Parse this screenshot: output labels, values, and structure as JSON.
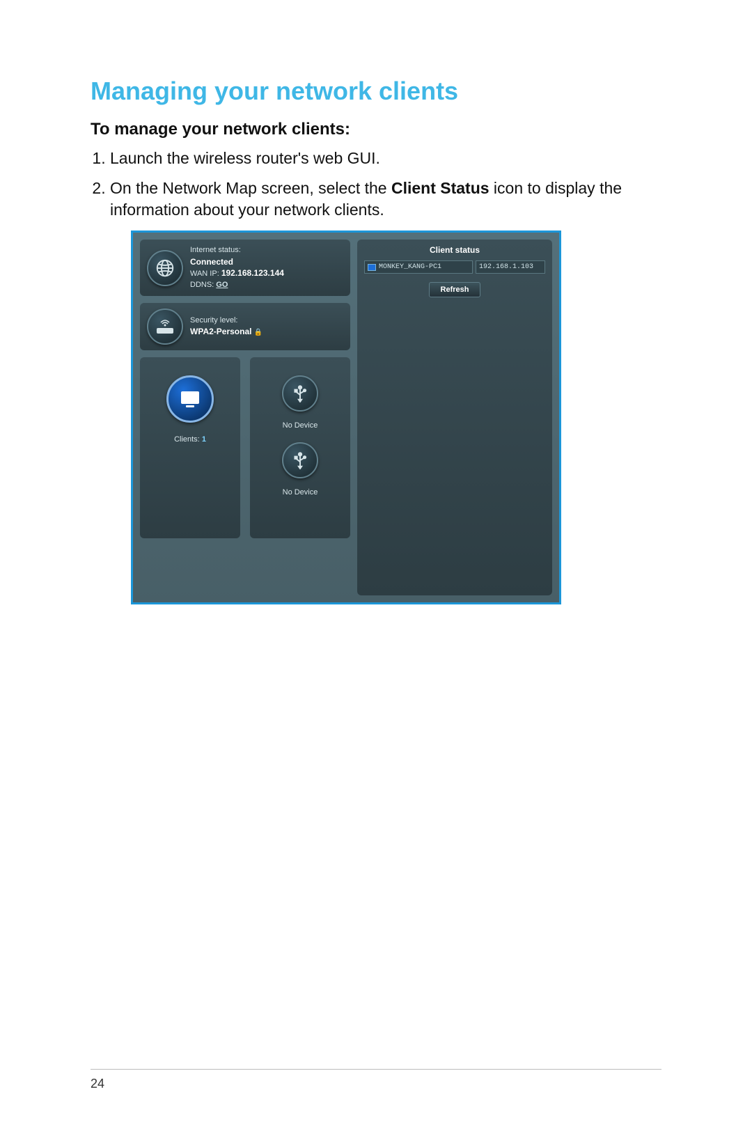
{
  "page_number": "24",
  "heading": "Managing your network clients",
  "subheading": "To manage your network clients:",
  "steps": {
    "s1": "Launch the wireless router's web GUI.",
    "s2_pre": "On the Network Map screen, select the ",
    "s2_bold": "Client Status",
    "s2_post": " icon to display the information about your network clients."
  },
  "netmap": {
    "internet": {
      "status_label": "Internet status:",
      "status_value": "Connected",
      "wan_label": "WAN IP:",
      "wan_value": "192.168.123.144",
      "ddns_label": "DDNS:",
      "ddns_link": "GO"
    },
    "security": {
      "label": "Security level:",
      "value": "WPA2-Personal"
    },
    "clients_card": {
      "label": "Clients:",
      "count": "1"
    },
    "usb1": {
      "label": "No Device"
    },
    "usb2": {
      "label": "No Device"
    },
    "panel": {
      "title": "Client status",
      "client_name": "MONKEY_KANG-PC1",
      "client_ip": "192.168.1.103",
      "refresh": "Refresh"
    }
  }
}
